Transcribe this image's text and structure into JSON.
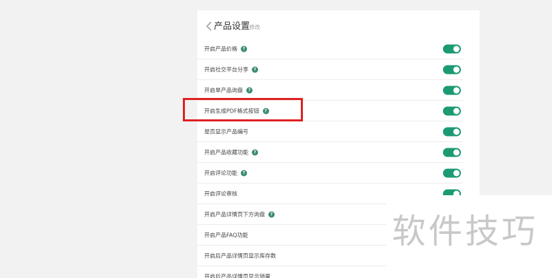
{
  "header": {
    "title": "产品设置",
    "edit_label": "修改"
  },
  "settings": [
    {
      "label": "开启产品价格",
      "help": true,
      "toggle": true
    },
    {
      "label": "开启社交平台分享",
      "help": true,
      "toggle": true
    },
    {
      "label": "开启单产品询盘",
      "help": true,
      "toggle": true
    },
    {
      "label": "开启生成PDF格式按钮",
      "help": true,
      "toggle": true
    },
    {
      "label": "是否显示产品编号",
      "help": false,
      "toggle": true
    },
    {
      "label": "开启产品收藏功能",
      "help": true,
      "toggle": true
    },
    {
      "label": "开启评论功能",
      "help": true,
      "toggle": true
    },
    {
      "label": "开启评论审核",
      "help": false,
      "toggle": true
    },
    {
      "label": "开启产品详情页下方询盘",
      "help": true,
      "toggle": false
    },
    {
      "label": "开启产品FAQ功能",
      "help": false,
      "toggle": false
    },
    {
      "label": "开启后产品详情页显示库存数",
      "help": false,
      "toggle": false
    },
    {
      "label": "开启后产品详情页显示销量",
      "help": false,
      "toggle": false
    }
  ],
  "help_glyph": "?",
  "watermark": "软件技巧",
  "colors": {
    "toggle_on": "#1b9a73",
    "help_badge": "#3a8a72",
    "highlight": "#e02020"
  }
}
